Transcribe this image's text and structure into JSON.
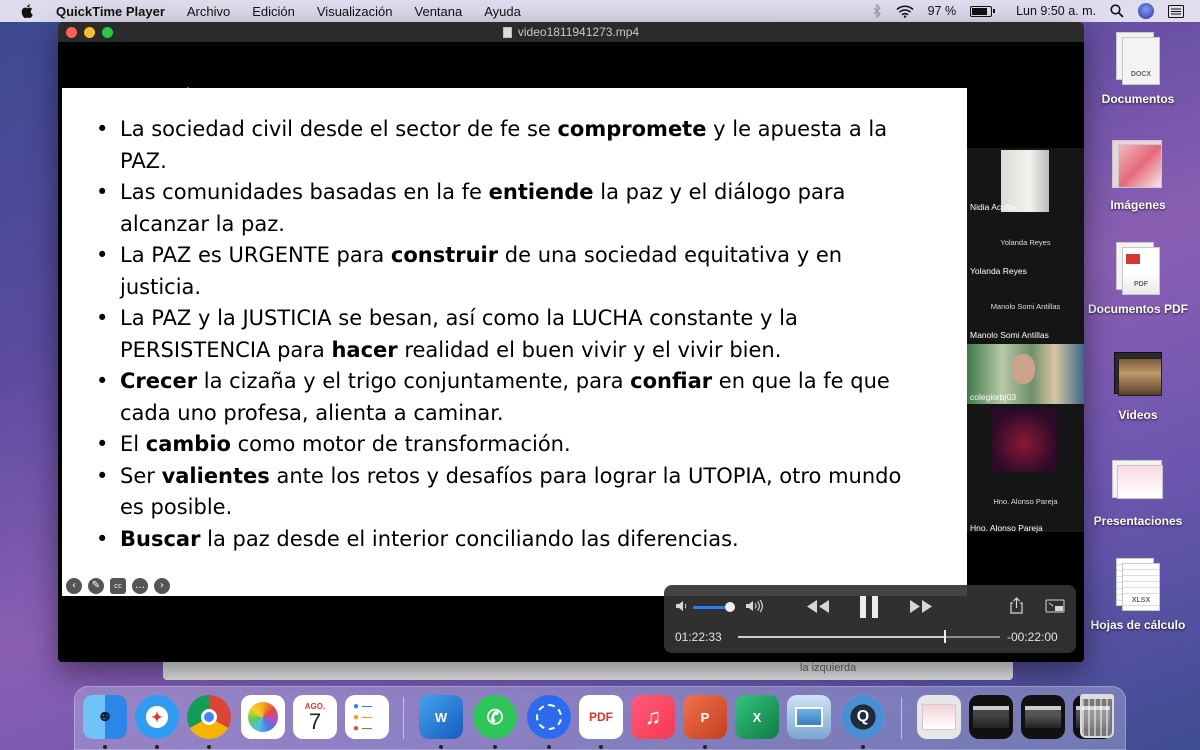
{
  "menubar": {
    "app_name": "QuickTime Player",
    "menus": [
      "Archivo",
      "Edición",
      "Visualización",
      "Ventana",
      "Ayuda"
    ],
    "battery": "97 %",
    "clock": "Lun 9:50 a. m."
  },
  "window": {
    "title": "video1811941273.mp4"
  },
  "slide": {
    "bullets": [
      {
        "pre": "La sociedad civil desde el sector de fe se ",
        "bold": "compromete",
        "post": " y le apuesta a la PAZ."
      },
      {
        "pre": "Las comunidades basadas en la fe ",
        "bold": "entiende",
        "post": " la paz y el diálogo para alcanzar la paz."
      },
      {
        "pre": "La PAZ es URGENTE para ",
        "bold": "construir",
        "post": " de una sociedad equitativa y en justicia."
      },
      {
        "pre": "La PAZ y la JUSTICIA se besan, así como la LUCHA constante y la PERSISTENCIA para ",
        "bold": "hacer",
        "post": " realidad el buen vivir y el vivir bien."
      },
      {
        "pre": "",
        "bold": "Crecer",
        "post": " la cizaña y el trigo conjuntamente, para ",
        "bold2": "confiar",
        "post2": " en que la fe que cada uno profesa, alienta a caminar."
      },
      {
        "pre": "El ",
        "bold": "cambio",
        "post": " como motor de transformación."
      },
      {
        "pre": "Ser ",
        "bold": "valientes",
        "post": " ante los retos y desafíos para lograr la UTOPIA, otro mundo es posible."
      },
      {
        "pre": "",
        "bold": "Buscar",
        "post": " la paz desde el interior conciliando las diferencias."
      }
    ]
  },
  "participants": [
    {
      "name": "Nidia Acuña",
      "caption": ""
    },
    {
      "name": "Yolanda Reyes",
      "caption": "Yolanda Reyes"
    },
    {
      "name": "Manolo Somi Antillas",
      "caption": "Manolo Somi Antillas"
    },
    {
      "name": "colegiorb|03",
      "caption": ""
    },
    {
      "name": "Hno. Alonso Pareja",
      "caption": "Hno. Alonso Pareja"
    }
  ],
  "player": {
    "elapsed": "01:22:33",
    "remaining": "-00:22:00",
    "progress": 0.79,
    "volume": 0.88,
    "icons": [
      "volume-low-icon",
      "volume-high-icon",
      "rewind-icon",
      "pause-icon",
      "fast-forward-icon",
      "share-icon",
      "picture-in-picture-icon"
    ]
  },
  "behind_window_text": "la izquierda",
  "desktop_icons": [
    {
      "label": "Documentos",
      "badge": "DOCX"
    },
    {
      "label": "Imágenes",
      "badge": ""
    },
    {
      "label": "Documentos PDF",
      "badge": "PDF"
    },
    {
      "label": "Videos",
      "badge": ""
    },
    {
      "label": "Presentaciones",
      "badge": ""
    },
    {
      "label": "Hojas de cálculo",
      "badge": "XLSX"
    }
  ],
  "dock": {
    "calendar_month": "AGO.",
    "calendar_day": "7",
    "apps": [
      "Finder",
      "Safari",
      "Chrome",
      "Photos",
      "Calendar",
      "Reminders",
      "Word",
      "WhatsApp",
      "Signal",
      "PDF Expert",
      "Music",
      "PowerPoint",
      "Excel",
      "Preview",
      "QuickTime",
      "Downloads",
      "Window 1",
      "Window 2",
      "Window 3",
      "Trash"
    ]
  },
  "colors": {
    "accent_blue": "#2f7df6",
    "close": "#ff5f57",
    "minimize": "#febc2e",
    "maximize": "#28c840"
  }
}
